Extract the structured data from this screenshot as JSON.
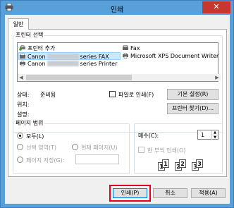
{
  "window": {
    "title": "인쇄",
    "close_label": "✕"
  },
  "tabs": [
    {
      "label": "일반"
    }
  ],
  "printer_select": {
    "group_label": "프린터 선택",
    "printers": [
      {
        "label": "프린터 추가",
        "icon": "add-printer-icon"
      },
      {
        "label": "Fax",
        "icon": "fax-icon"
      },
      {
        "prefix": "Canon",
        "suffix": "series FAX",
        "icon": "fax-printer-icon",
        "selected": true
      },
      {
        "label": "Microsoft XPS Document Writer",
        "icon": "printer-icon"
      },
      {
        "prefix": "Canon",
        "suffix": "series Printer",
        "icon": "printer-icon"
      }
    ],
    "status_label": "상태:",
    "status_value": "준비됨",
    "location_label": "위치:",
    "comment_label": "설명:",
    "print_to_file_label": "파일로 인쇄(F)",
    "preferences_button": "기본 설정(R)",
    "find_printer_button": "프린터 찾기(D)..."
  },
  "page_range": {
    "group_label": "페이지 범위",
    "all_label": "모두(L)",
    "selection_label": "선택 영역(T)",
    "current_page_label": "현재 페이지(U)",
    "pages_label": "페이지 지정(G):",
    "pages_value": ""
  },
  "copies": {
    "label": "매수(C):",
    "value": "1",
    "collate_label": "한 부씩 인쇄(O)",
    "collate_pages": [
      "1",
      "1",
      "2",
      "2",
      "3",
      "3"
    ]
  },
  "buttons": {
    "print": "인쇄(P)",
    "cancel": "취소",
    "apply": "적용(A)"
  }
}
